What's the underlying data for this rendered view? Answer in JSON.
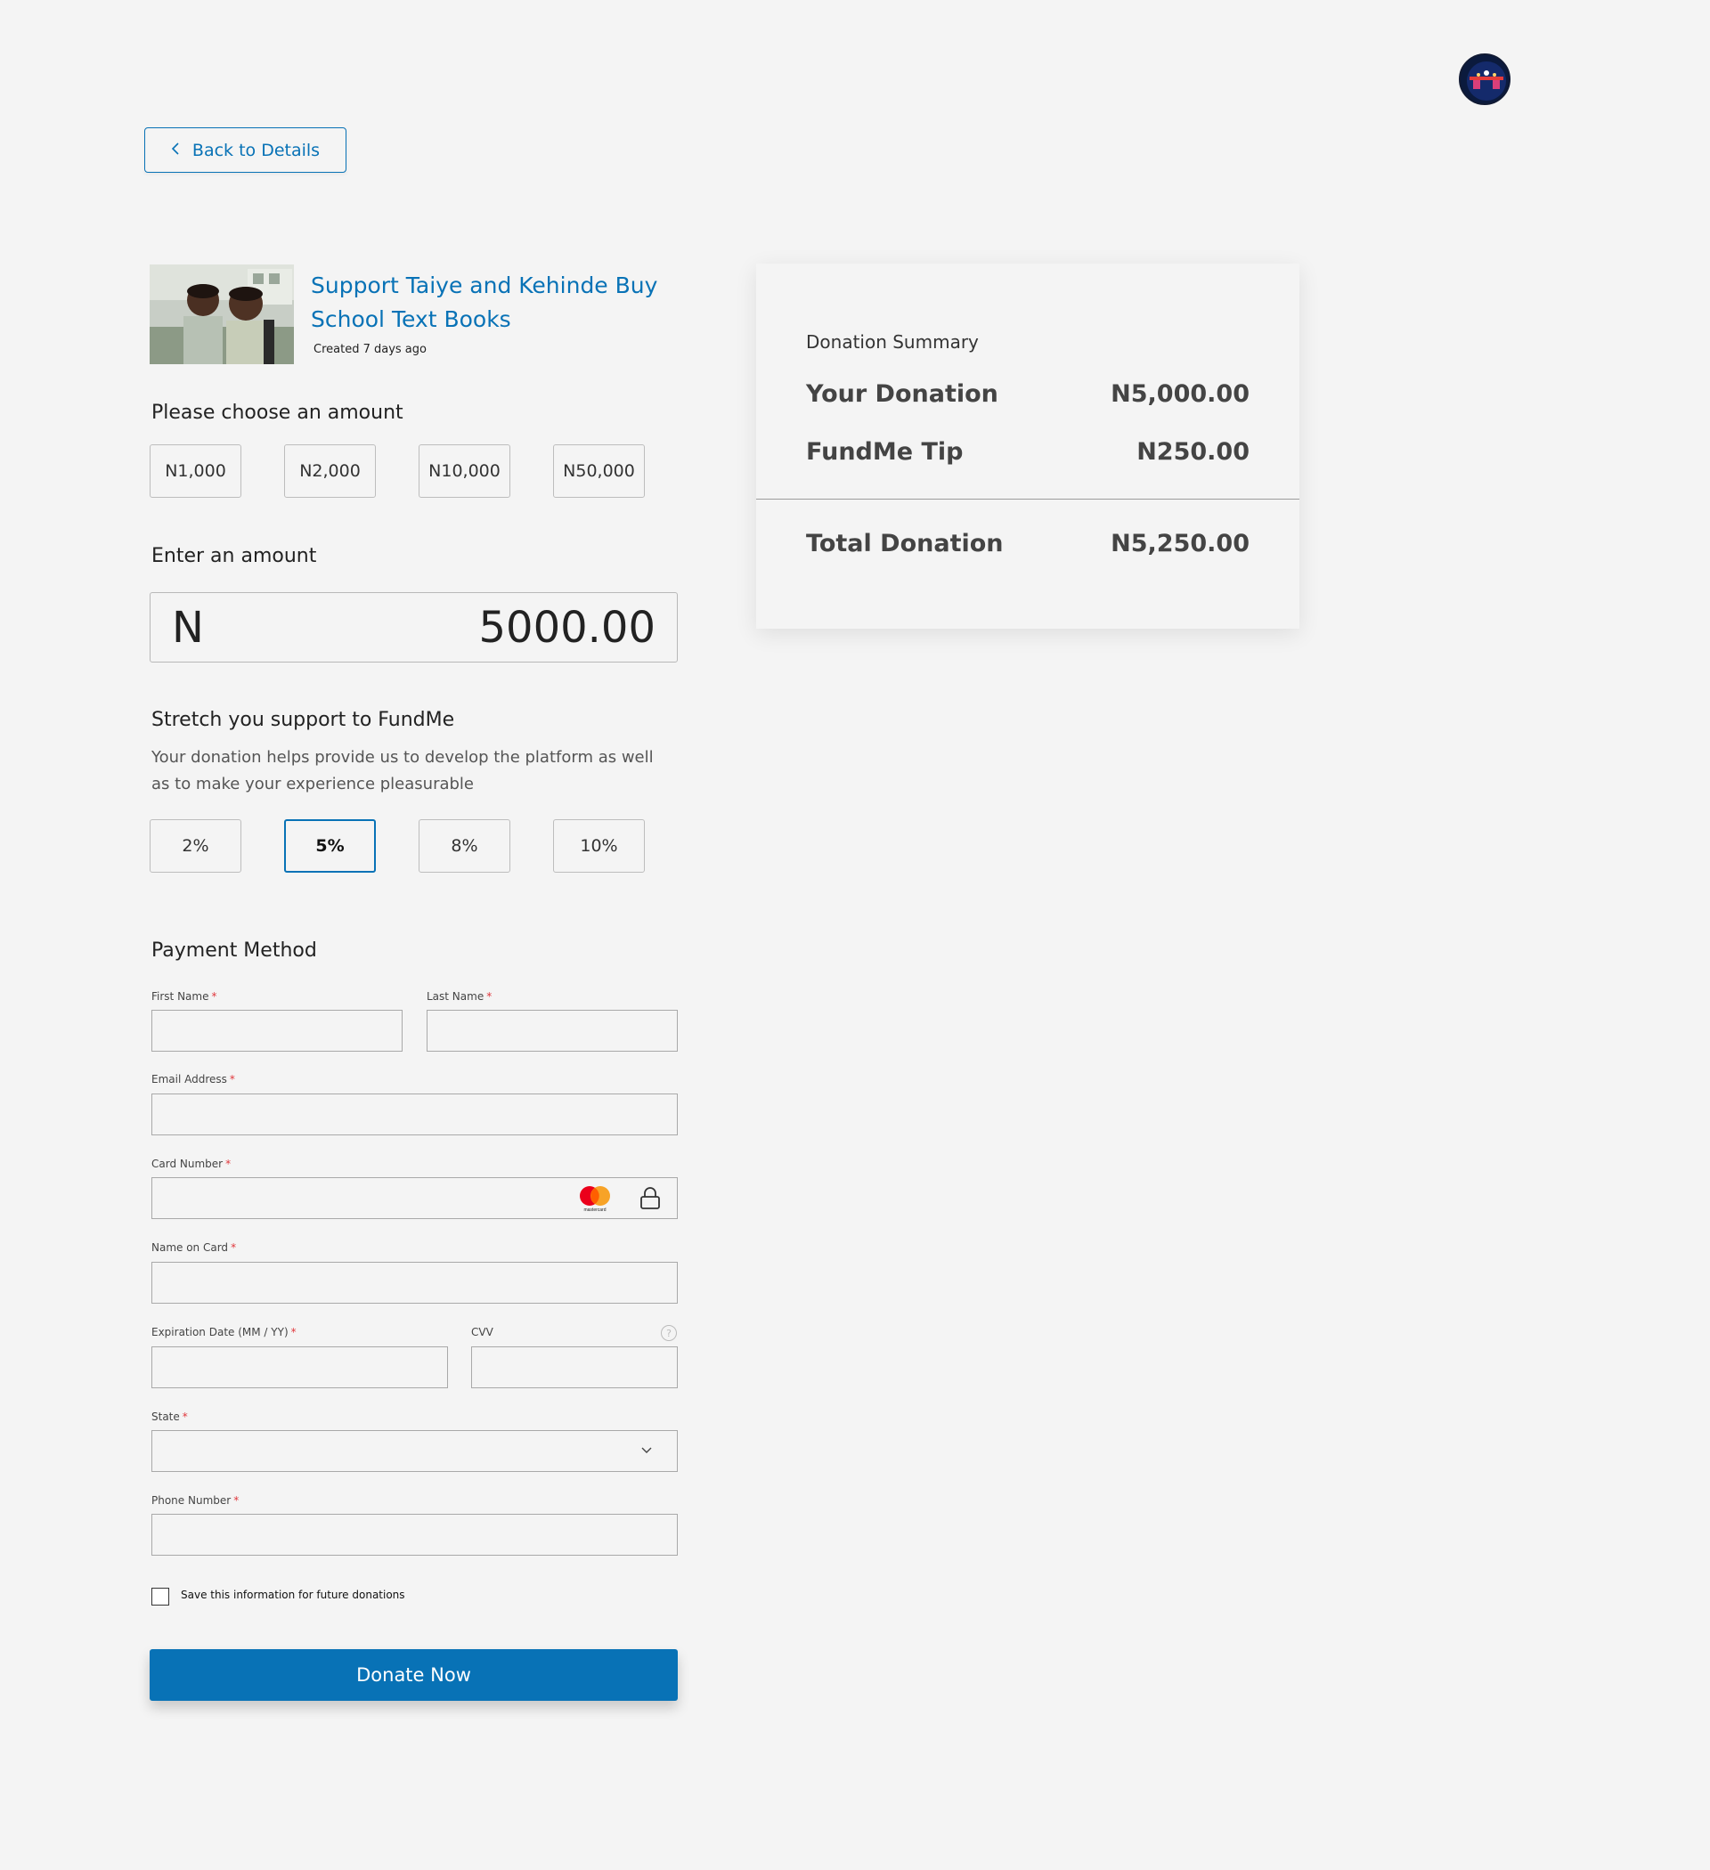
{
  "header": {
    "avatar_icon": "user-avatar-photo"
  },
  "navigation": {
    "back_label": "Back to Details",
    "back_icon": "chevron-left-icon"
  },
  "campaign": {
    "title": "Support Taiye and Kehinde Buy School Text Books",
    "meta": "Created 7 days ago",
    "image_icon": "campaign-photo"
  },
  "amount_section": {
    "heading": "Please choose an amount",
    "options": [
      "N1,000",
      "N2,000",
      "N10,000",
      "N50,000"
    ]
  },
  "enter_amount": {
    "heading": "Enter an amount",
    "currency": "N",
    "value": "5000.00"
  },
  "stretch": {
    "heading": "Stretch you support to FundMe",
    "description": "Your donation helps provide us to develop the platform as well as to make your experience pleasurable",
    "options": [
      "2%",
      "5%",
      "8%",
      "10%"
    ],
    "selected": "5%"
  },
  "payment": {
    "heading": "Payment Method",
    "required_marker": "*",
    "fields": {
      "first_name": "First Name",
      "last_name": "Last Name",
      "email": "Email Address",
      "card_number": "Card Number",
      "name_on_card": "Name on Card",
      "expiration": "Expiration Date (MM / YY)",
      "cvv": "CVV",
      "state": "State",
      "phone": "Phone Number"
    },
    "card_brand_icon": "mastercard-icon",
    "card_brand_label": "mastercard",
    "lock_icon": "lock-icon",
    "help_icon": "question-circle-icon",
    "help_glyph": "?",
    "select_icon": "chevron-down-icon",
    "save_info_label": "Save this information for future donations",
    "save_info_checked": false,
    "submit_label": "Donate Now"
  },
  "summary": {
    "title": "Donation Summary",
    "rows": [
      {
        "label": "Your Donation",
        "value": "N5,000.00"
      },
      {
        "label": "FundMe Tip",
        "value": "N250.00"
      }
    ],
    "total": {
      "label": "Total Donation",
      "value": "N5,250.00"
    }
  },
  "colors": {
    "accent": "#0872b6",
    "background": "#f4f4f4",
    "required": "#e0373c"
  }
}
